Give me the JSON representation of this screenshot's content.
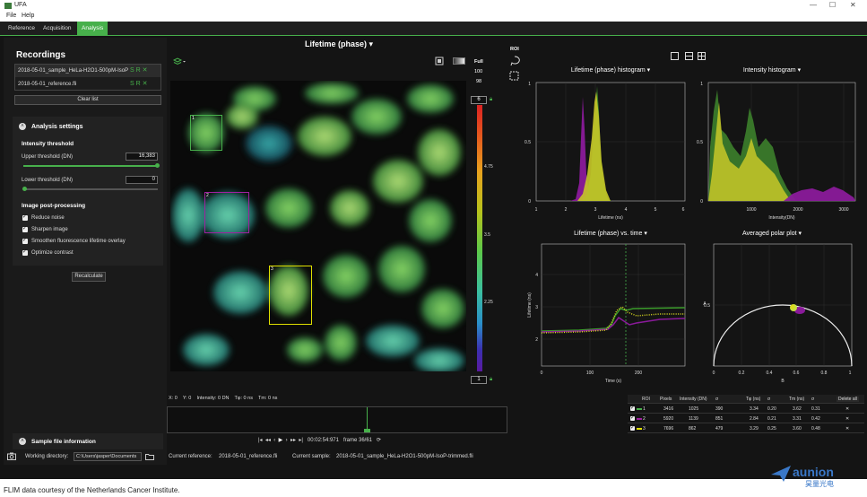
{
  "window": {
    "title": "UFA",
    "min": "—",
    "max": "☐",
    "close": "✕"
  },
  "menu": [
    "File",
    "Help"
  ],
  "tabs": [
    "Reference",
    "Acquisition",
    "Analysis"
  ],
  "sidebar": {
    "recordings_title": "Recordings",
    "recordings": [
      {
        "name": "2018-05-01_sample_HeLa-H2O1-500pM-IsoP",
        "actions": "S R ✕"
      },
      {
        "name": "2018-05-01_reference.fli",
        "actions": "S R ✕"
      }
    ],
    "clear_list": "Clear list",
    "analysis_settings": "Analysis settings",
    "intensity_threshold": "Intensity threshold",
    "upper_label": "Upper threshold (DN)",
    "upper_value": "16,383",
    "upper_fraction": 1.0,
    "lower_label": "Lower threshold (DN)",
    "lower_value": "0",
    "lower_fraction": 0.0,
    "post_processing": "Image post-processing",
    "checks": [
      "Reduce noise",
      "Sharpen image",
      "Smoothen fluorescence lifetime overlay",
      "Optimize contrast"
    ],
    "recalculate": "Recalculate",
    "sample_info": "Sample file information",
    "working_dir_label": "Working directory:",
    "working_dir": "C:\\Users\\jasper\\Documents"
  },
  "center": {
    "title": "Lifetime (phase) ▾",
    "full_label": "Full",
    "full_val1": "100",
    "full_val2": "98",
    "cb_top": "6",
    "cb_bottom": "1",
    "cb_ticks": [
      "4.75",
      "3.5",
      "2.25"
    ],
    "roi_labels": [
      "1",
      "2",
      "3"
    ]
  },
  "right": {
    "roi_label": "ROI",
    "hist1_title": "Lifetime (phase) histogram ▾",
    "hist1_xlabel": "Lifetime (ns)",
    "hist1_xticks": [
      "1",
      "2",
      "3",
      "4",
      "5",
      "6"
    ],
    "hist1_yticks": [
      "1",
      "0.5",
      "0"
    ],
    "hist2_title": "Intensity histogram ▾",
    "hist2_xlabel": "Intensity(DN)",
    "hist2_xticks": [
      "1000",
      "2000",
      "3000"
    ],
    "hist2_yticks": [
      "1",
      "0.5",
      "0"
    ],
    "time_title": "Lifetime (phase) vs. time ▾",
    "time_xlabel": "Time (s)",
    "time_ylabel": "Lifetime (ns)",
    "time_xticks": [
      "0",
      "100",
      "200"
    ],
    "time_yticks": [
      "4",
      "3",
      "2"
    ],
    "polar_title": "Averaged polar plot ▾",
    "polar_xlabel": "B",
    "polar_ylabel": "A",
    "polar_xticks": [
      "0",
      "0.2",
      "0.4",
      "0.6",
      "0.8",
      "1"
    ],
    "polar_ytick": "0.5"
  },
  "readout": {
    "x_label": "X:",
    "x": "0",
    "y_label": "Y:",
    "y": "0",
    "int_label": "Intensity:",
    "int": "0",
    "int_unit": "DN",
    "tphi_label": "Tφ:",
    "tphi": "0",
    "tphi_unit": "ns",
    "tm_label": "Tm:",
    "tm": "0",
    "tm_unit": "ns"
  },
  "playback": {
    "time": "00:02:54:971",
    "frame": "frame 36/61"
  },
  "status": {
    "ref_label": "Current reference:",
    "ref": "2018-05-01_reference.fli",
    "sample_label": "Current sample:",
    "sample": "2018-05-01_sample_HeLa-H2O1-500pM-IsoP-trimmed.fli"
  },
  "table": {
    "headers": [
      "ROI",
      "Pixels",
      "Intensity (DN)",
      "σ",
      "Tφ (ns)",
      "σ",
      "Tm (ns)",
      "σ",
      "Delete all"
    ],
    "rows": [
      {
        "roi": "1",
        "color": "#47b04b",
        "pixels": "3416",
        "int": "1025",
        "int_s": "390",
        "tphi": "3.34",
        "tphi_s": "0.20",
        "tm": "3.62",
        "tm_s": "0.31"
      },
      {
        "roi": "2",
        "color": "#a020a0",
        "pixels": "5920",
        "int": "1139",
        "int_s": "851",
        "tphi": "2.84",
        "tphi_s": "0.21",
        "tm": "3.31",
        "tm_s": "0.42"
      },
      {
        "roi": "3",
        "color": "#e0e000",
        "pixels": "7696",
        "int": "862",
        "int_s": "479",
        "tphi": "3.29",
        "tphi_s": "0.25",
        "tm": "3.60",
        "tm_s": "0.48"
      }
    ]
  },
  "footer": {
    "caption": "FLIM data courtesy of the Netherlands Cancer Institute.",
    "brand": "aunion",
    "brand_cn": "昊量光电"
  },
  "colors": {
    "accent": "#47b04b",
    "roi1": "#47b04b",
    "roi2": "#a020a0",
    "roi3": "#e0e000"
  }
}
